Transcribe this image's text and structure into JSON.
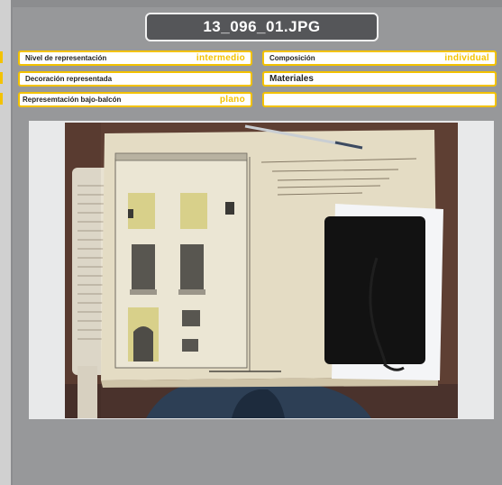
{
  "file": {
    "name": "13_096_01.JPG"
  },
  "fields": {
    "nivel": {
      "label": "Nivel de representación",
      "value": "intermedio"
    },
    "composicion": {
      "label": "Composición",
      "value": "individual"
    },
    "decoracion": {
      "label": "Decoración representada",
      "value": ""
    },
    "materiales": {
      "label": "Materiales",
      "value": ""
    },
    "bajo_balcon": {
      "label": "Represemtación bajo-balcón",
      "value": "plano"
    },
    "empty": {
      "label": "",
      "value": ""
    }
  },
  "colors": {
    "accent": "#f3c200",
    "title_bg": "#555659",
    "panel_bg": "#97989a"
  }
}
